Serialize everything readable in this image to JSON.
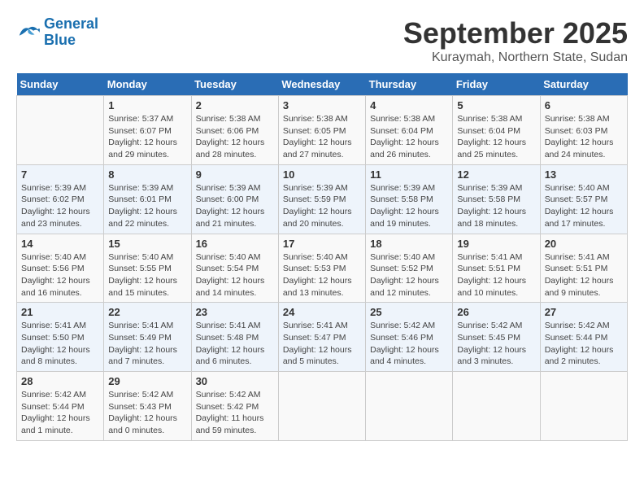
{
  "logo": {
    "line1": "General",
    "line2": "Blue"
  },
  "title": "September 2025",
  "subtitle": "Kuraymah, Northern State, Sudan",
  "days_of_week": [
    "Sunday",
    "Monday",
    "Tuesday",
    "Wednesday",
    "Thursday",
    "Friday",
    "Saturday"
  ],
  "weeks": [
    [
      {
        "day": "",
        "info": ""
      },
      {
        "day": "1",
        "info": "Sunrise: 5:37 AM\nSunset: 6:07 PM\nDaylight: 12 hours\nand 29 minutes."
      },
      {
        "day": "2",
        "info": "Sunrise: 5:38 AM\nSunset: 6:06 PM\nDaylight: 12 hours\nand 28 minutes."
      },
      {
        "day": "3",
        "info": "Sunrise: 5:38 AM\nSunset: 6:05 PM\nDaylight: 12 hours\nand 27 minutes."
      },
      {
        "day": "4",
        "info": "Sunrise: 5:38 AM\nSunset: 6:04 PM\nDaylight: 12 hours\nand 26 minutes."
      },
      {
        "day": "5",
        "info": "Sunrise: 5:38 AM\nSunset: 6:04 PM\nDaylight: 12 hours\nand 25 minutes."
      },
      {
        "day": "6",
        "info": "Sunrise: 5:38 AM\nSunset: 6:03 PM\nDaylight: 12 hours\nand 24 minutes."
      }
    ],
    [
      {
        "day": "7",
        "info": "Sunrise: 5:39 AM\nSunset: 6:02 PM\nDaylight: 12 hours\nand 23 minutes."
      },
      {
        "day": "8",
        "info": "Sunrise: 5:39 AM\nSunset: 6:01 PM\nDaylight: 12 hours\nand 22 minutes."
      },
      {
        "day": "9",
        "info": "Sunrise: 5:39 AM\nSunset: 6:00 PM\nDaylight: 12 hours\nand 21 minutes."
      },
      {
        "day": "10",
        "info": "Sunrise: 5:39 AM\nSunset: 5:59 PM\nDaylight: 12 hours\nand 20 minutes."
      },
      {
        "day": "11",
        "info": "Sunrise: 5:39 AM\nSunset: 5:58 PM\nDaylight: 12 hours\nand 19 minutes."
      },
      {
        "day": "12",
        "info": "Sunrise: 5:39 AM\nSunset: 5:58 PM\nDaylight: 12 hours\nand 18 minutes."
      },
      {
        "day": "13",
        "info": "Sunrise: 5:40 AM\nSunset: 5:57 PM\nDaylight: 12 hours\nand 17 minutes."
      }
    ],
    [
      {
        "day": "14",
        "info": "Sunrise: 5:40 AM\nSunset: 5:56 PM\nDaylight: 12 hours\nand 16 minutes."
      },
      {
        "day": "15",
        "info": "Sunrise: 5:40 AM\nSunset: 5:55 PM\nDaylight: 12 hours\nand 15 minutes."
      },
      {
        "day": "16",
        "info": "Sunrise: 5:40 AM\nSunset: 5:54 PM\nDaylight: 12 hours\nand 14 minutes."
      },
      {
        "day": "17",
        "info": "Sunrise: 5:40 AM\nSunset: 5:53 PM\nDaylight: 12 hours\nand 13 minutes."
      },
      {
        "day": "18",
        "info": "Sunrise: 5:40 AM\nSunset: 5:52 PM\nDaylight: 12 hours\nand 12 minutes."
      },
      {
        "day": "19",
        "info": "Sunrise: 5:41 AM\nSunset: 5:51 PM\nDaylight: 12 hours\nand 10 minutes."
      },
      {
        "day": "20",
        "info": "Sunrise: 5:41 AM\nSunset: 5:51 PM\nDaylight: 12 hours\nand 9 minutes."
      }
    ],
    [
      {
        "day": "21",
        "info": "Sunrise: 5:41 AM\nSunset: 5:50 PM\nDaylight: 12 hours\nand 8 minutes."
      },
      {
        "day": "22",
        "info": "Sunrise: 5:41 AM\nSunset: 5:49 PM\nDaylight: 12 hours\nand 7 minutes."
      },
      {
        "day": "23",
        "info": "Sunrise: 5:41 AM\nSunset: 5:48 PM\nDaylight: 12 hours\nand 6 minutes."
      },
      {
        "day": "24",
        "info": "Sunrise: 5:41 AM\nSunset: 5:47 PM\nDaylight: 12 hours\nand 5 minutes."
      },
      {
        "day": "25",
        "info": "Sunrise: 5:42 AM\nSunset: 5:46 PM\nDaylight: 12 hours\nand 4 minutes."
      },
      {
        "day": "26",
        "info": "Sunrise: 5:42 AM\nSunset: 5:45 PM\nDaylight: 12 hours\nand 3 minutes."
      },
      {
        "day": "27",
        "info": "Sunrise: 5:42 AM\nSunset: 5:44 PM\nDaylight: 12 hours\nand 2 minutes."
      }
    ],
    [
      {
        "day": "28",
        "info": "Sunrise: 5:42 AM\nSunset: 5:44 PM\nDaylight: 12 hours\nand 1 minute."
      },
      {
        "day": "29",
        "info": "Sunrise: 5:42 AM\nSunset: 5:43 PM\nDaylight: 12 hours\nand 0 minutes."
      },
      {
        "day": "30",
        "info": "Sunrise: 5:42 AM\nSunset: 5:42 PM\nDaylight: 11 hours\nand 59 minutes."
      },
      {
        "day": "",
        "info": ""
      },
      {
        "day": "",
        "info": ""
      },
      {
        "day": "",
        "info": ""
      },
      {
        "day": "",
        "info": ""
      }
    ]
  ]
}
